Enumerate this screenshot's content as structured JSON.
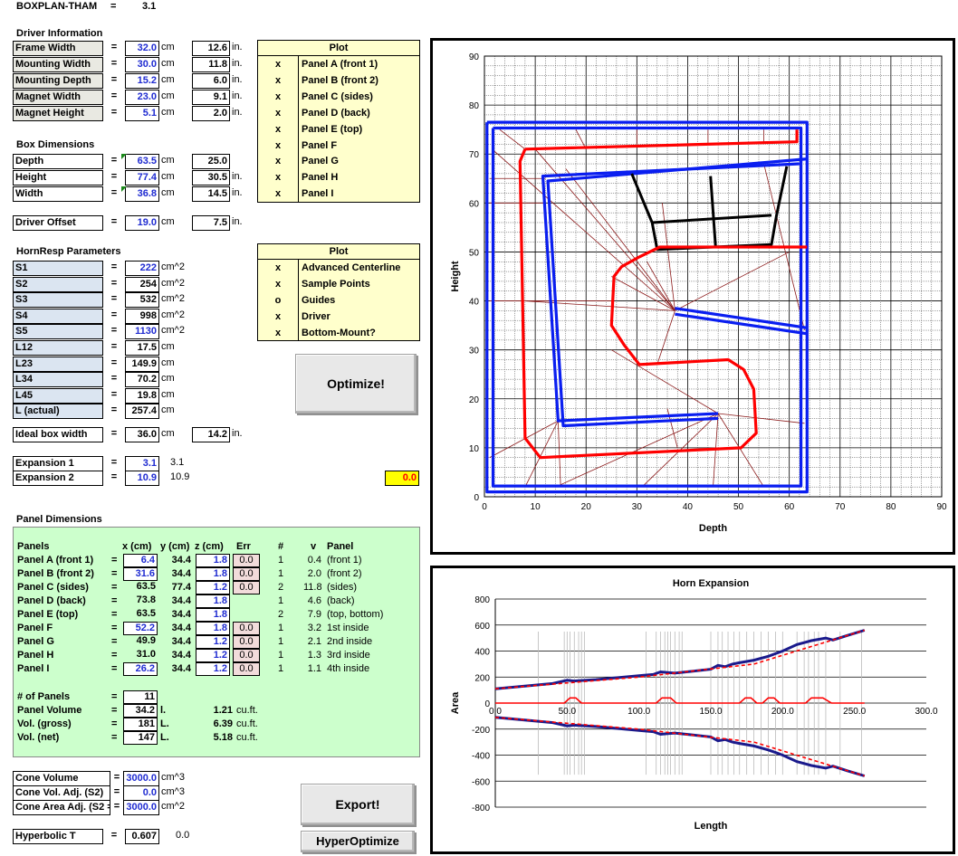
{
  "header": {
    "title": "BOXPLAN-THAM",
    "eq": "=",
    "version": "3.1"
  },
  "driver": {
    "section": "Driver Information",
    "rows": [
      {
        "label": "Frame Width",
        "value": "32.0",
        "unit": "cm",
        "conv": "12.6",
        "conv_unit": "in."
      },
      {
        "label": "Mounting Width",
        "value": "30.0",
        "unit": "cm",
        "conv": "11.8",
        "conv_unit": "in."
      },
      {
        "label": "Mounting Depth",
        "value": "15.2",
        "unit": "cm",
        "conv": "6.0",
        "conv_unit": "in."
      },
      {
        "label": "Magnet Width",
        "value": "23.0",
        "unit": "cm",
        "conv": "9.1",
        "conv_unit": "in."
      },
      {
        "label": "Magnet Height",
        "value": "5.1",
        "unit": "cm",
        "conv": "2.0",
        "conv_unit": "in."
      }
    ]
  },
  "box": {
    "section": "Box Dimensions",
    "rows": [
      {
        "label": "Depth",
        "value": "63.5",
        "unit": "cm",
        "conv": "25.0",
        "conv_unit": ""
      },
      {
        "label": "Height",
        "value": "77.4",
        "unit": "cm",
        "conv": "30.5",
        "conv_unit": "in."
      },
      {
        "label": "Width",
        "value": "36.8",
        "unit": "cm",
        "conv": "14.5",
        "conv_unit": "in."
      }
    ]
  },
  "offset": {
    "label": "Driver Offset",
    "value": "19.0",
    "unit": "cm",
    "conv": "7.5",
    "conv_unit": "in."
  },
  "plot1": {
    "header": "Plot",
    "rows": [
      {
        "mark": "x",
        "label": "Panel A (front 1)"
      },
      {
        "mark": "x",
        "label": "Panel B (front 2)"
      },
      {
        "mark": "x",
        "label": "Panel C (sides)"
      },
      {
        "mark": "x",
        "label": "Panel D (back)"
      },
      {
        "mark": "x",
        "label": "Panel E (top)"
      },
      {
        "mark": "x",
        "label": "Panel F"
      },
      {
        "mark": "x",
        "label": "Panel G"
      },
      {
        "mark": "x",
        "label": "Panel H"
      },
      {
        "mark": "x",
        "label": "Panel I"
      }
    ]
  },
  "hornresp": {
    "section": "HornResp Parameters",
    "rows": [
      {
        "label": "S1",
        "value": "222",
        "unit": "cm^2",
        "blue": true
      },
      {
        "label": "S2",
        "value": "254",
        "unit": "cm^2",
        "blue": false
      },
      {
        "label": "S3",
        "value": "532",
        "unit": "cm^2",
        "blue": false
      },
      {
        "label": "S4",
        "value": "998",
        "unit": "cm^2",
        "blue": false
      },
      {
        "label": "S5",
        "value": "1130",
        "unit": "cm^2",
        "blue": true
      },
      {
        "label": "L12",
        "value": "17.5",
        "unit": "cm",
        "blue": false
      },
      {
        "label": "L23",
        "value": "149.9",
        "unit": "cm",
        "blue": false
      },
      {
        "label": "L34",
        "value": "70.2",
        "unit": "cm",
        "blue": false
      },
      {
        "label": "L45",
        "value": "19.8",
        "unit": "cm",
        "blue": false
      },
      {
        "label": "L (actual)",
        "value": "257.4",
        "unit": "cm",
        "blue": false
      }
    ]
  },
  "plot2": {
    "header": "Plot",
    "rows": [
      {
        "mark": "x",
        "label": "Advanced Centerline"
      },
      {
        "mark": "x",
        "label": "Sample Points"
      },
      {
        "mark": "o",
        "label": "Guides"
      },
      {
        "mark": "x",
        "label": "Driver"
      },
      {
        "mark": "x",
        "label": "Bottom-Mount?"
      }
    ]
  },
  "buttons": {
    "optimize": "Optimize!",
    "export": "Export!",
    "hyperoptimize": "HyperOptimize"
  },
  "ideal": {
    "label": "Ideal box width",
    "value": "36.0",
    "unit": "cm",
    "conv": "14.2",
    "conv_unit": "in."
  },
  "expansion": {
    "rows": [
      {
        "label": "Expansion 1",
        "value": "3.1",
        "extra": "3.1"
      },
      {
        "label": "Expansion 2",
        "value": "10.9",
        "extra": "10.9"
      }
    ],
    "warning": "0.0"
  },
  "panels": {
    "section": "Panel Dimensions",
    "headers": {
      "panels": "Panels",
      "x": "x (cm)",
      "y": "y (cm)",
      "z": "z (cm)",
      "err": "Err",
      "num": "#",
      "v": "v",
      "panel": "Panel"
    },
    "rows": [
      {
        "label": "Panel A (front 1)",
        "x": "6.4",
        "y": "34.4",
        "z": "1.8",
        "err": "0.0",
        "num": "1",
        "v": "0.4",
        "desc": "(front 1)",
        "xb": true
      },
      {
        "label": "Panel B (front 2)",
        "x": "31.6",
        "y": "34.4",
        "z": "1.8",
        "err": "0.0",
        "num": "1",
        "v": "2.0",
        "desc": "(front 2)",
        "xb": true
      },
      {
        "label": "Panel C (sides)",
        "x": "63.5",
        "y": "77.4",
        "z": "1.2",
        "err": "0.0",
        "num": "2",
        "v": "11.8",
        "desc": "(sides)",
        "xb": false
      },
      {
        "label": "Panel D (back)",
        "x": "73.8",
        "y": "34.4",
        "z": "1.8",
        "err": "",
        "num": "1",
        "v": "4.6",
        "desc": "(back)",
        "xb": false
      },
      {
        "label": "Panel E (top)",
        "x": "63.5",
        "y": "34.4",
        "z": "1.8",
        "err": "",
        "num": "2",
        "v": "7.9",
        "desc": "(top, bottom)",
        "xb": false
      },
      {
        "label": "Panel F",
        "x": "52.2",
        "y": "34.4",
        "z": "1.8",
        "err": "0.0",
        "num": "1",
        "v": "3.2",
        "desc": "1st inside",
        "xb": true
      },
      {
        "label": "Panel G",
        "x": "49.9",
        "y": "34.4",
        "z": "1.2",
        "err": "0.0",
        "num": "1",
        "v": "2.1",
        "desc": "2nd inside",
        "xb": false
      },
      {
        "label": "Panel H",
        "x": "31.0",
        "y": "34.4",
        "z": "1.2",
        "err": "0.0",
        "num": "1",
        "v": "1.3",
        "desc": "3rd inside",
        "xb": false
      },
      {
        "label": "Panel I",
        "x": "26.2",
        "y": "34.4",
        "z": "1.2",
        "err": "0.0",
        "num": "1",
        "v": "1.1",
        "desc": "4th inside",
        "xb": true
      }
    ],
    "summary": [
      {
        "label": "# of Panels",
        "value": "11",
        "unit": "",
        "cf": "",
        "cf_unit": ""
      },
      {
        "label": "Panel Volume",
        "value": "34.2",
        "unit": "l.",
        "cf": "1.21",
        "cf_unit": "cu.ft."
      },
      {
        "label": "Vol. (gross)",
        "value": "181",
        "unit": "L.",
        "cf": "6.39",
        "cf_unit": "cu.ft."
      },
      {
        "label": "Vol. (net)",
        "value": "147",
        "unit": "L.",
        "cf": "5.18",
        "cf_unit": "cu.ft."
      }
    ]
  },
  "cone": {
    "rows": [
      {
        "label": "Cone Volume",
        "value": "3000.0",
        "unit": "cm^3"
      },
      {
        "label": "Cone Vol. Adj. (S2)",
        "value": "0.0",
        "unit": "cm^3"
      },
      {
        "label": "Cone Area Adj. (S2 =",
        "value": "3000.0",
        "unit": "cm^2"
      }
    ]
  },
  "hyperbolic": {
    "label": "Hyperbolic T",
    "value": "0.607",
    "extra": "0.0"
  },
  "colors": {
    "blue_value": "#1f2bd1",
    "plot_bg": "#ffffcc",
    "panel_bg": "#ccffcc",
    "warn_bg": "#ffff00",
    "warn_fg": "#ff0000",
    "red": "#ff0000",
    "blue": "#0a1ef0",
    "navy": "#1a1a8c"
  },
  "chart_data": [
    {
      "type": "line",
      "title": "",
      "xlabel": "Depth",
      "ylabel": "Height",
      "xlim": [
        0,
        90
      ],
      "ylim": [
        0,
        90
      ],
      "xticks": [
        "0",
        "10",
        "20",
        "30",
        "40",
        "50",
        "60",
        "70",
        "80",
        "90"
      ],
      "yticks": [
        "0",
        "10",
        "20",
        "30",
        "40",
        "50",
        "60",
        "70",
        "80",
        "90"
      ],
      "grid": true,
      "series": [
        {
          "color": "#0a1ef0",
          "points": [
            [
              0.5,
              76.5
            ],
            [
              63.5,
              76.5
            ],
            [
              63.5,
              1
            ],
            [
              0.5,
              1
            ],
            [
              0.5,
              76.5
            ]
          ]
        },
        {
          "color": "#0a1ef0",
          "points": [
            [
              1.7,
              75.3
            ],
            [
              62.3,
              75.3
            ],
            [
              62.3,
              2.2
            ],
            [
              1.7,
              2.2
            ],
            [
              1.7,
              75.3
            ]
          ]
        },
        {
          "color": "#0a1ef0",
          "points": [
            [
              62,
              68
            ],
            [
              11.5,
              65.5
            ],
            [
              14.5,
              15.5
            ],
            [
              46,
              17
            ]
          ]
        },
        {
          "color": "#0a1ef0",
          "points": [
            [
              63.5,
              69
            ],
            [
              12.5,
              64.5
            ],
            [
              15.5,
              14.5
            ],
            [
              46,
              16
            ]
          ]
        },
        {
          "color": "#0a1ef0",
          "points": [
            [
              37.5,
              38.5
            ],
            [
              63.5,
              34.5
            ]
          ]
        },
        {
          "color": "#0a1ef0",
          "points": [
            [
              37.5,
              37.3
            ],
            [
              63.5,
              33.3
            ]
          ]
        },
        {
          "color": "#000000",
          "points": [
            [
              29,
              66
            ],
            [
              33,
              56
            ],
            [
              34,
              50.5
            ],
            [
              56.5,
              51.5
            ],
            [
              57.5,
              57.5
            ],
            [
              59.5,
              67.5
            ]
          ]
        },
        {
          "color": "#000000",
          "points": [
            [
              33,
              56
            ],
            [
              56.5,
              57.5
            ]
          ]
        },
        {
          "color": "#000000",
          "points": [
            [
              44.5,
              65.5
            ],
            [
              45.5,
              51
            ]
          ]
        },
        {
          "color": "#ff0000",
          "points": [
            [
              8,
              71
            ],
            [
              7,
              68.5
            ],
            [
              8,
              12
            ],
            [
              11,
              8
            ],
            [
              50.5,
              10
            ],
            [
              53.5,
              13
            ],
            [
              53,
              22
            ],
            [
              51,
              26
            ],
            [
              48,
              28
            ],
            [
              30.5,
              27
            ],
            [
              27.5,
              31
            ],
            [
              25,
              35
            ],
            [
              25.5,
              45
            ],
            [
              27,
              47
            ],
            [
              30.5,
              49
            ],
            [
              34.5,
              51
            ],
            [
              63.5,
              51
            ]
          ]
        },
        {
          "color": "#ff0000",
          "points": [
            [
              8,
              71
            ],
            [
              61.5,
              72.5
            ],
            [
              61.5,
              75
            ]
          ]
        }
      ]
    },
    {
      "type": "line",
      "title": "Horn Expansion",
      "xlabel": "Length",
      "ylabel": "Area",
      "xlim": [
        0,
        300
      ],
      "ylim": [
        -800,
        800
      ],
      "xticks": [
        "0.0",
        "50.0",
        "100.0",
        "150.0",
        "200.0",
        "250.0",
        "300.0"
      ],
      "yticks": [
        "800",
        "600",
        "400",
        "200",
        "0",
        "-200",
        "-400",
        "-600",
        "-800"
      ],
      "grid": true,
      "series": [
        {
          "name": "",
          "color": "#1a1a8c",
          "points": [
            [
              0,
              110
            ],
            [
              40,
              150
            ],
            [
              50,
              175
            ],
            [
              55,
              170
            ],
            [
              70,
              180
            ],
            [
              100,
              210
            ],
            [
              110,
              220
            ],
            [
              115,
              240
            ],
            [
              120,
              235
            ],
            [
              125,
              230
            ],
            [
              150,
              260
            ],
            [
              155,
              290
            ],
            [
              160,
              280
            ],
            [
              165,
              300
            ],
            [
              170,
              310
            ],
            [
              180,
              330
            ],
            [
              190,
              360
            ],
            [
              195,
              380
            ],
            [
              200,
              400
            ],
            [
              210,
              450
            ],
            [
              220,
              480
            ],
            [
              230,
              500
            ],
            [
              235,
              485
            ],
            [
              245,
              520
            ],
            [
              257,
              560
            ]
          ]
        },
        {
          "name": "",
          "color": "#1a1a8c",
          "points": [
            [
              0,
              -110
            ],
            [
              40,
              -150
            ],
            [
              50,
              -175
            ],
            [
              55,
              -170
            ],
            [
              70,
              -180
            ],
            [
              100,
              -210
            ],
            [
              110,
              -220
            ],
            [
              115,
              -240
            ],
            [
              120,
              -235
            ],
            [
              125,
              -230
            ],
            [
              150,
              -260
            ],
            [
              155,
              -290
            ],
            [
              160,
              -280
            ],
            [
              165,
              -300
            ],
            [
              170,
              -310
            ],
            [
              180,
              -330
            ],
            [
              190,
              -360
            ],
            [
              195,
              -380
            ],
            [
              200,
              -400
            ],
            [
              210,
              -450
            ],
            [
              220,
              -480
            ],
            [
              230,
              -500
            ],
            [
              235,
              -485
            ],
            [
              245,
              -520
            ],
            [
              257,
              -560
            ]
          ]
        },
        {
          "name": "",
          "color": "#ff0000",
          "points": [
            [
              0,
              110
            ],
            [
              100,
              200
            ],
            [
              180,
              300
            ],
            [
              257,
              560
            ]
          ]
        },
        {
          "name": "",
          "color": "#ff0000",
          "points": [
            [
              0,
              -110
            ],
            [
              100,
              -200
            ],
            [
              180,
              -300
            ],
            [
              257,
              -560
            ]
          ]
        },
        {
          "name": "",
          "color": "#ff0000",
          "points": [
            [
              0,
              0
            ],
            [
              48,
              0
            ],
            [
              52,
              40
            ],
            [
              56,
              40
            ],
            [
              60,
              0
            ],
            [
              112,
              0
            ],
            [
              116,
              40
            ],
            [
              122,
              40
            ],
            [
              126,
              0
            ],
            [
              170,
              0
            ],
            [
              174,
              40
            ],
            [
              178,
              40
            ],
            [
              182,
              0
            ],
            [
              186,
              0
            ],
            [
              190,
              40
            ],
            [
              194,
              40
            ],
            [
              198,
              0
            ],
            [
              216,
              0
            ],
            [
              220,
              40
            ],
            [
              228,
              40
            ],
            [
              234,
              0
            ],
            [
              257,
              0
            ]
          ]
        }
      ]
    }
  ]
}
